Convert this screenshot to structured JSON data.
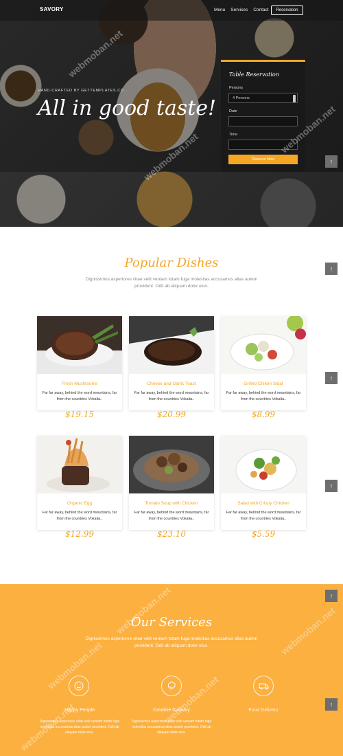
{
  "nav": {
    "logo": "SAVORY",
    "links": [
      "Menu",
      "Services",
      "Contact"
    ],
    "reservation_button": "Reservation"
  },
  "hero": {
    "credit": "HAND-CRAFTED BY GETTEMPLATES.CO",
    "tagline": "All in good taste!"
  },
  "reservation": {
    "title": "Table Reservation",
    "persons_label": "Persons",
    "persons_value": "4 Persons",
    "date_label": "Date",
    "time_label": "Time",
    "submit": "Reserve Now"
  },
  "dishes": {
    "title": "Popular Dishes",
    "subtitle": "Dignissimos asperiores vitae velit veniam totam fuga molestias accusamus alias autem provident. Odit ab aliquam dolor eius.",
    "items": [
      {
        "name": "Fresh Mushrooms",
        "desc": "Far far away, behind the word mountains, far from the countries Vokalia..",
        "price": "$19.15"
      },
      {
        "name": "Cheese and Garlic Toast",
        "desc": "Far far away, behind the word mountains, far from the countries Vokalia..",
        "price": "$20.99"
      },
      {
        "name": "Grilled Chiken Salat",
        "desc": "Far far away, behind the word mountains, far from the countries Vokalia..",
        "price": "$8.99"
      },
      {
        "name": "Organic Egg",
        "desc": "Far far away, behind the word mountains, far from the countries Vokalia..",
        "price": "$12.99"
      },
      {
        "name": "Tomato Soup with Chicken",
        "desc": "Far far away, behind the word mountains, far from the countries Vokalia..",
        "price": "$23.10"
      },
      {
        "name": "Salad with Crispy Chicken",
        "desc": "Far far away, behind the word mountains, far from the countries Vokalia..",
        "price": "$5.59"
      }
    ]
  },
  "services": {
    "title": "Our Services",
    "subtitle": "Dignissimos asperiores vitae velit veniam totam fuga molestias accusamus alias autem provident. Odit ab aliquam dolor eius.",
    "items": [
      {
        "name": "Happy People",
        "desc": "Dignissimos asperiores vitae velit veniam totam fuga molestias accusamus alias autem provident. Odit ab aliquam dolor eius.",
        "icon": "smiley-icon"
      },
      {
        "name": "Creative Culinary",
        "desc": "Dignissimos asperiores vitae velit veniam totam fuga molestias accusamus alias autem provident. Odit ab aliquam dolor eius.",
        "icon": "chef-hat-icon"
      },
      {
        "name": "Food Delivery",
        "desc": "",
        "icon": "delivery-truck-icon"
      }
    ]
  },
  "watermark": "webmoban.net",
  "back_to_top": "↑",
  "colors": {
    "accent": "#f5a623",
    "services_bg": "#fbb040"
  }
}
